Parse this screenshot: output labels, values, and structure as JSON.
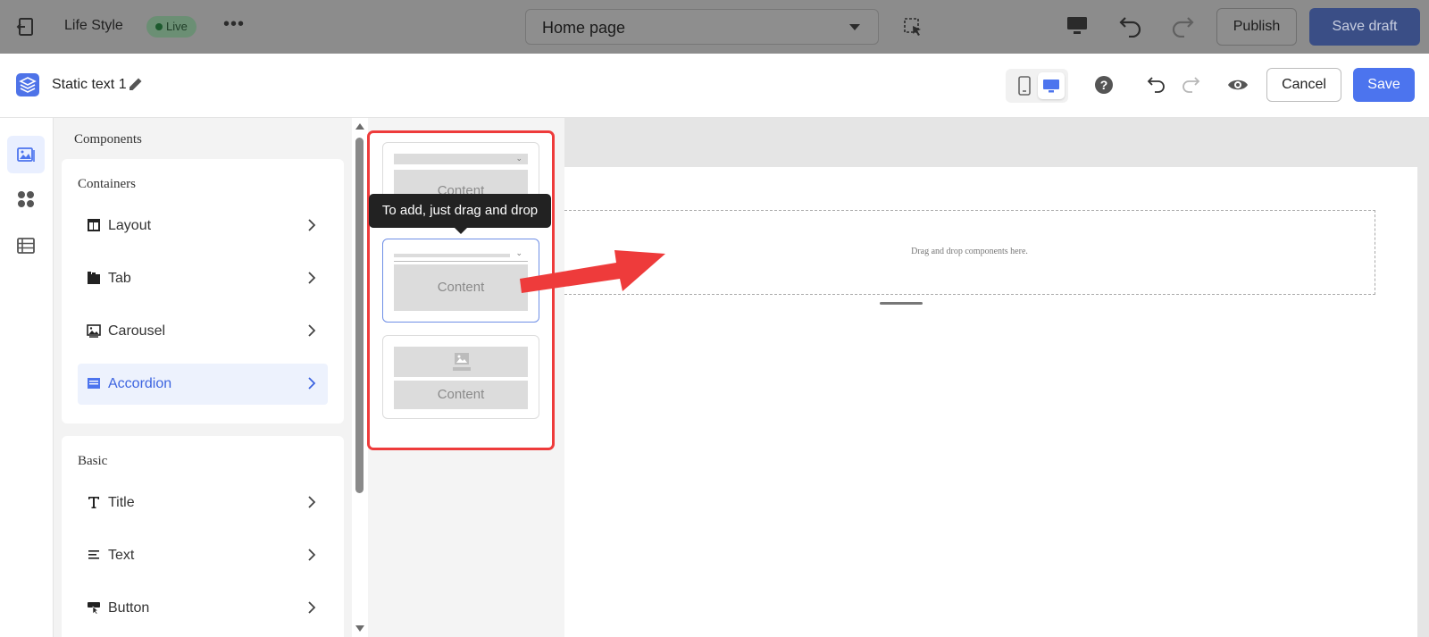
{
  "appbar": {
    "site_name": "Life Style",
    "status_badge": "Live",
    "page_select": {
      "value": "Home page"
    },
    "publish_label": "Publish",
    "save_draft_label": "Save draft"
  },
  "editor_header": {
    "title": "Static text 1",
    "cancel_label": "Cancel",
    "save_label": "Save"
  },
  "components_panel": {
    "heading": "Components",
    "groups": [
      {
        "label": "Containers",
        "items": [
          {
            "label": "Layout",
            "icon": "layout-icon"
          },
          {
            "label": "Tab",
            "icon": "tab-icon"
          },
          {
            "label": "Carousel",
            "icon": "image-icon"
          },
          {
            "label": "Accordion",
            "icon": "accordion-icon",
            "active": true
          }
        ]
      },
      {
        "label": "Basic",
        "items": [
          {
            "label": "Title",
            "icon": "title-t-icon"
          },
          {
            "label": "Text",
            "icon": "text-lines-icon"
          },
          {
            "label": "Button",
            "icon": "button-icon"
          }
        ]
      }
    ]
  },
  "variants_panel": {
    "variants": [
      {
        "content_label": "Content"
      },
      {
        "content_label": "Content"
      },
      {
        "content_label": "Content"
      }
    ],
    "tooltip": "To add, just drag and drop"
  },
  "canvas": {
    "dropzone_hint": "Drag and drop components here."
  },
  "colors": {
    "accent": "#4c74ee",
    "highlight_frame": "#ee3b3b",
    "tooltip_bg": "#222222"
  }
}
